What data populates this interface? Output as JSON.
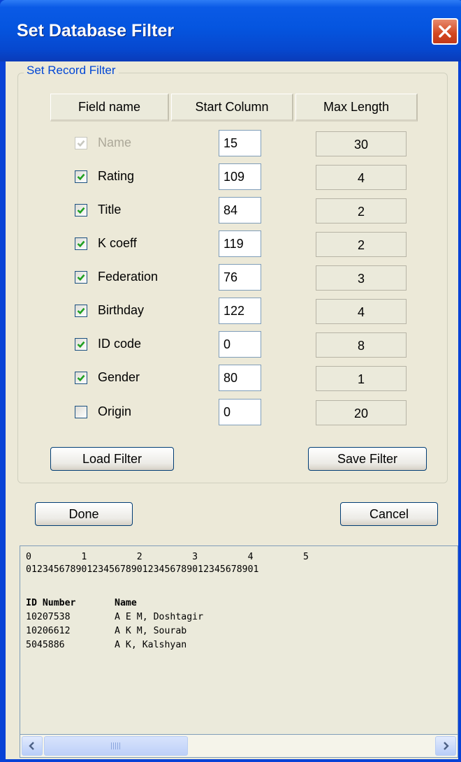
{
  "window": {
    "title": "Set Database Filter"
  },
  "group": {
    "label": "Set Record Filter"
  },
  "headers": {
    "field_name": "Field name",
    "start_column": "Start Column",
    "max_length": "Max Length"
  },
  "fields": [
    {
      "label": "Name",
      "checked": true,
      "enabled": false,
      "start": "15",
      "maxlen": "30"
    },
    {
      "label": "Rating",
      "checked": true,
      "enabled": true,
      "start": "109",
      "maxlen": "4"
    },
    {
      "label": "Title",
      "checked": true,
      "enabled": true,
      "start": "84",
      "maxlen": "2"
    },
    {
      "label": "K coeff",
      "checked": true,
      "enabled": true,
      "start": "119",
      "maxlen": "2"
    },
    {
      "label": "Federation",
      "checked": true,
      "enabled": true,
      "start": "76",
      "maxlen": "3"
    },
    {
      "label": "Birthday",
      "checked": true,
      "enabled": true,
      "start": "122",
      "maxlen": "4"
    },
    {
      "label": "ID code",
      "checked": true,
      "enabled": true,
      "start": "0",
      "maxlen": "8"
    },
    {
      "label": "Gender",
      "checked": true,
      "enabled": true,
      "start": "80",
      "maxlen": "1"
    },
    {
      "label": "Origin",
      "checked": false,
      "enabled": true,
      "start": "0",
      "maxlen": "20"
    }
  ],
  "buttons": {
    "load_filter": "Load Filter",
    "save_filter": "Save Filter",
    "done": "Done",
    "cancel": "Cancel"
  },
  "preview": {
    "ruler_tens": "0         1         2         3         4         5",
    "ruler_digits": "012345678901234567890123456789012345678901",
    "header_line": "ID Number       Name",
    "records": [
      "10207538        A E M, Doshtagir",
      "10206612        A K M, Sourab",
      "5045886         A K, Kalshyan"
    ]
  },
  "scrollbar": {
    "left_icon": "arrow-left-icon",
    "right_icon": "arrow-right-icon"
  },
  "colors": {
    "titlebar": "#0555df",
    "close": "#d3471f",
    "dialog_bg": "#ece9d8",
    "group_label": "#0046d5",
    "check": "#21a121"
  }
}
